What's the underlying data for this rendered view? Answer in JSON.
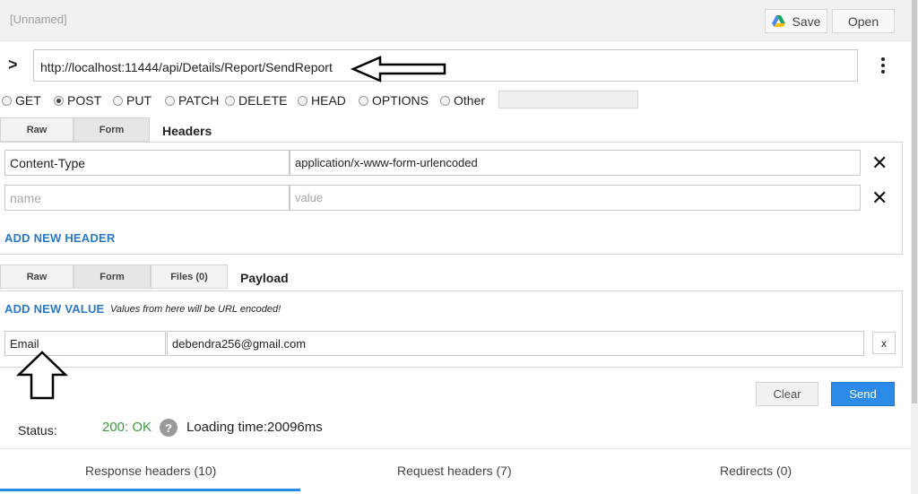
{
  "app": {
    "title": "[Unnamed]",
    "save_label": "Save",
    "open_label": "Open"
  },
  "request": {
    "url": "http://localhost:11444/api/Details/Report/SendReport"
  },
  "methods": {
    "get": "GET",
    "post": "POST",
    "put": "PUT",
    "patch": "PATCH",
    "delete": "DELETE",
    "head": "HEAD",
    "options": "OPTIONS",
    "other": "Other",
    "selected": "POST"
  },
  "headers_section": {
    "tab_raw": "Raw",
    "tab_form": "Form",
    "title": "Headers",
    "rows": [
      {
        "name": "Content-Type",
        "value": "application/x-www-form-urlencoded"
      }
    ],
    "name_placeholder": "name",
    "value_placeholder": "value",
    "add_label": "ADD NEW HEADER"
  },
  "payload_section": {
    "tab_raw": "Raw",
    "tab_form": "Form",
    "tab_files": "Files (0)",
    "title": "Payload",
    "add_label": "ADD NEW VALUE",
    "hint": "Values from here will be URL encoded!",
    "rows": [
      {
        "name": "Email",
        "value": "debendra256@gmail.com"
      }
    ],
    "remove_label": "x"
  },
  "actions": {
    "clear": "Clear",
    "send": "Send"
  },
  "status": {
    "label": "Status:",
    "code": "200: OK",
    "help": "?",
    "loading": "Loading time:20096ms"
  },
  "response_tabs": {
    "response_headers": "Response headers (10)",
    "request_headers": "Request headers (7)",
    "redirects": "Redirects (0)"
  },
  "colors": {
    "accent": "#2b8be6",
    "link": "#2a78c8",
    "status_ok": "#3c9a3c"
  }
}
